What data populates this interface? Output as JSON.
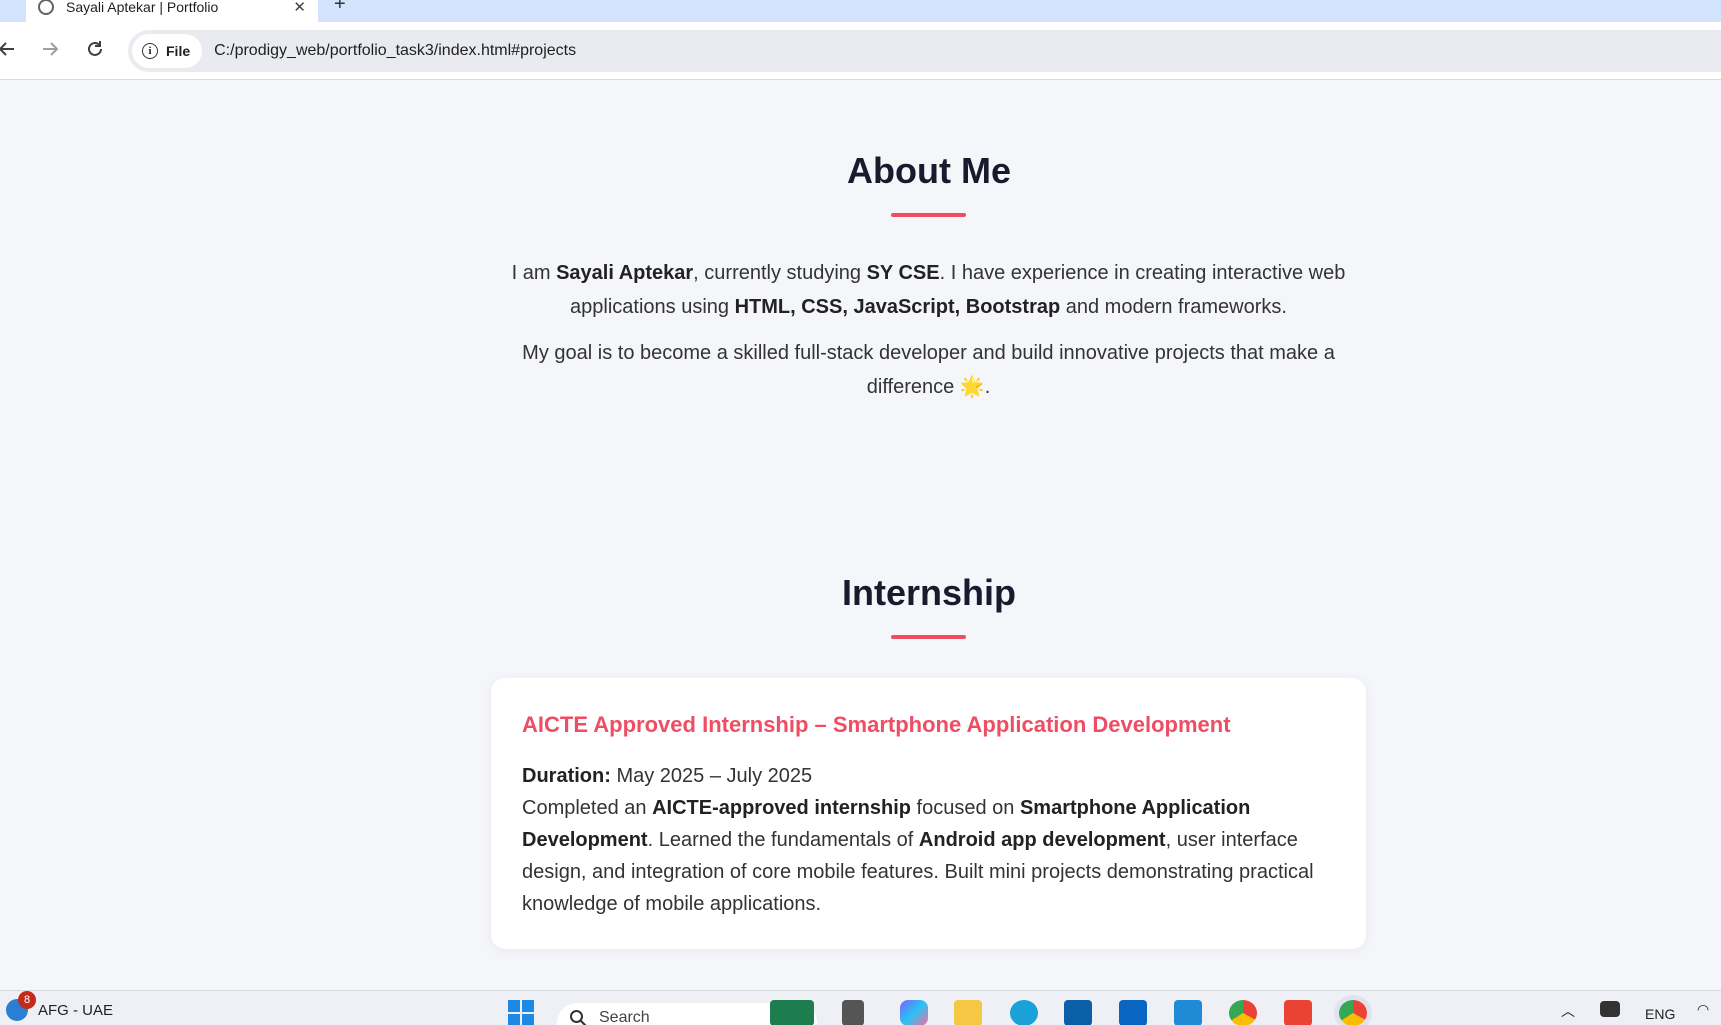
{
  "browser": {
    "tab_title": "Sayali Aptekar | Portfolio",
    "tab_close": "✕",
    "new_tab": "+",
    "back_icon": "arrow-left-icon",
    "forward_icon": "arrow-right-icon",
    "reload_icon": "reload-icon",
    "site_chip_label": "File",
    "url": "C:/prodigy_web/portfolio_task3/index.html#projects"
  },
  "about": {
    "title": "About Me",
    "p1": {
      "t1": "I am ",
      "name": "Sayali Aptekar",
      "t2": ", currently studying ",
      "course": "SY CSE",
      "t3": ". I have experience in creating interactive web applications using ",
      "skills": "HTML, CSS, JavaScript, Bootstrap",
      "t4": " and modern frameworks."
    },
    "p2": {
      "text": "My goal is to become a skilled full-stack developer and build innovative projects that make a difference ",
      "emoji": "🌟",
      "end": "."
    }
  },
  "internship": {
    "title": "Internship",
    "card_title": "AICTE Approved Internship – Smartphone Application Development",
    "duration_label": "Duration:",
    "duration_value": " May 2025 – July 2025",
    "d1": "Completed an ",
    "b1": "AICTE-approved internship",
    "d2": " focused on ",
    "b2": "Smartphone Application Development",
    "d3": ". Learned the fundamentals of ",
    "b3": "Android app development",
    "d4": ", user interface design, and integration of core mobile features. Built mini projects demonstrating practical knowledge of mobile applications."
  },
  "taskbar": {
    "weather_badge": "8",
    "weather_text": "AFG - UAE",
    "search_placeholder": "Search",
    "language": "ENG",
    "accent": "#ef4d63"
  }
}
